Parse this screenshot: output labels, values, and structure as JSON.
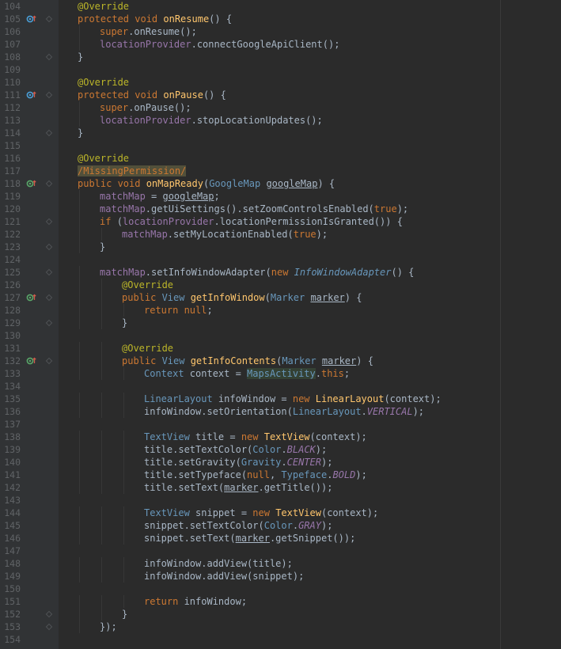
{
  "lines": [
    {
      "n": "104",
      "indent": 1,
      "fold": false,
      "icon": null,
      "segs": [
        {
          "t": "@Override",
          "c": "an"
        }
      ]
    },
    {
      "n": "105",
      "indent": 1,
      "fold": true,
      "icon": "override",
      "segs": [
        {
          "t": "protected ",
          "c": "k"
        },
        {
          "t": "void ",
          "c": "k"
        },
        {
          "t": "onResume",
          "c": "m"
        },
        {
          "t": "() {",
          "c": ""
        }
      ]
    },
    {
      "n": "106",
      "indent": 2,
      "fold": false,
      "icon": null,
      "segs": [
        {
          "t": "super",
          "c": "k"
        },
        {
          "t": ".onResume();",
          "c": ""
        }
      ]
    },
    {
      "n": "107",
      "indent": 2,
      "fold": false,
      "icon": null,
      "segs": [
        {
          "t": "locationProvider",
          "c": "f"
        },
        {
          "t": ".connectGoogleApiClient();",
          "c": ""
        }
      ]
    },
    {
      "n": "108",
      "indent": 1,
      "fold": true,
      "icon": null,
      "segs": [
        {
          "t": "}",
          "c": ""
        }
      ]
    },
    {
      "n": "109",
      "indent": 0,
      "fold": false,
      "icon": null,
      "segs": []
    },
    {
      "n": "110",
      "indent": 1,
      "fold": false,
      "icon": null,
      "segs": [
        {
          "t": "@Override",
          "c": "an"
        }
      ]
    },
    {
      "n": "111",
      "indent": 1,
      "fold": true,
      "icon": "override",
      "segs": [
        {
          "t": "protected ",
          "c": "k"
        },
        {
          "t": "void ",
          "c": "k"
        },
        {
          "t": "onPause",
          "c": "m"
        },
        {
          "t": "() {",
          "c": ""
        }
      ]
    },
    {
      "n": "112",
      "indent": 2,
      "fold": false,
      "icon": null,
      "segs": [
        {
          "t": "super",
          "c": "k"
        },
        {
          "t": ".onPause();",
          "c": ""
        }
      ]
    },
    {
      "n": "113",
      "indent": 2,
      "fold": false,
      "icon": null,
      "segs": [
        {
          "t": "locationProvider",
          "c": "f"
        },
        {
          "t": ".stopLocationUpdates();",
          "c": ""
        }
      ]
    },
    {
      "n": "114",
      "indent": 1,
      "fold": true,
      "icon": null,
      "segs": [
        {
          "t": "}",
          "c": ""
        }
      ]
    },
    {
      "n": "115",
      "indent": 0,
      "fold": false,
      "icon": null,
      "segs": []
    },
    {
      "n": "116",
      "indent": 1,
      "fold": false,
      "icon": null,
      "segs": [
        {
          "t": "@Override",
          "c": "an"
        }
      ]
    },
    {
      "n": "117",
      "indent": 1,
      "fold": false,
      "icon": null,
      "segs": [
        {
          "t": "/MissingPermission/",
          "c": "warn"
        }
      ]
    },
    {
      "n": "118",
      "indent": 1,
      "fold": true,
      "icon": "implement",
      "segs": [
        {
          "t": "public ",
          "c": "k"
        },
        {
          "t": "void ",
          "c": "k"
        },
        {
          "t": "onMapReady",
          "c": "m"
        },
        {
          "t": "(",
          "c": ""
        },
        {
          "t": "GoogleMap ",
          "c": "t"
        },
        {
          "t": "googleMap",
          "c": "u"
        },
        {
          "t": ") {",
          "c": ""
        }
      ]
    },
    {
      "n": "119",
      "indent": 2,
      "fold": false,
      "icon": null,
      "segs": [
        {
          "t": "matchMap",
          "c": "f"
        },
        {
          "t": " = ",
          "c": ""
        },
        {
          "t": "googleMap",
          "c": "u"
        },
        {
          "t": ";",
          "c": ""
        }
      ]
    },
    {
      "n": "120",
      "indent": 2,
      "fold": false,
      "icon": null,
      "segs": [
        {
          "t": "matchMap",
          "c": "f"
        },
        {
          "t": ".getUiSettings().setZoomControlsEnabled(",
          "c": ""
        },
        {
          "t": "true",
          "c": "k"
        },
        {
          "t": ");",
          "c": ""
        }
      ]
    },
    {
      "n": "121",
      "indent": 2,
      "fold": true,
      "icon": null,
      "segs": [
        {
          "t": "if ",
          "c": "k"
        },
        {
          "t": "(",
          "c": ""
        },
        {
          "t": "locationProvider",
          "c": "f"
        },
        {
          "t": ".locationPermissionIsGranted()) {",
          "c": ""
        }
      ]
    },
    {
      "n": "122",
      "indent": 3,
      "fold": false,
      "icon": null,
      "segs": [
        {
          "t": "matchMap",
          "c": "f"
        },
        {
          "t": ".setMyLocationEnabled(",
          "c": ""
        },
        {
          "t": "true",
          "c": "k"
        },
        {
          "t": ");",
          "c": ""
        }
      ]
    },
    {
      "n": "123",
      "indent": 2,
      "fold": true,
      "icon": null,
      "segs": [
        {
          "t": "}",
          "c": ""
        }
      ]
    },
    {
      "n": "124",
      "indent": 0,
      "fold": false,
      "icon": null,
      "segs": []
    },
    {
      "n": "125",
      "indent": 2,
      "fold": true,
      "icon": null,
      "segs": [
        {
          "t": "matchMap",
          "c": "f"
        },
        {
          "t": ".setInfoWindowAdapter(",
          "c": ""
        },
        {
          "t": "new ",
          "c": "k"
        },
        {
          "t": "InfoWindowAdapter",
          "c": "ti"
        },
        {
          "t": "() {",
          "c": ""
        }
      ]
    },
    {
      "n": "126",
      "indent": 3,
      "fold": false,
      "icon": null,
      "segs": [
        {
          "t": "@Override",
          "c": "an"
        }
      ]
    },
    {
      "n": "127",
      "indent": 3,
      "fold": true,
      "icon": "implement",
      "segs": [
        {
          "t": "public ",
          "c": "k"
        },
        {
          "t": "View ",
          "c": "t"
        },
        {
          "t": "getInfoWindow",
          "c": "m"
        },
        {
          "t": "(",
          "c": ""
        },
        {
          "t": "Marker ",
          "c": "t"
        },
        {
          "t": "marker",
          "c": "u"
        },
        {
          "t": ") {",
          "c": ""
        }
      ]
    },
    {
      "n": "128",
      "indent": 4,
      "fold": false,
      "icon": null,
      "segs": [
        {
          "t": "return null",
          "c": "k"
        },
        {
          "t": ";",
          "c": ""
        }
      ]
    },
    {
      "n": "129",
      "indent": 3,
      "fold": true,
      "icon": null,
      "segs": [
        {
          "t": "}",
          "c": ""
        }
      ]
    },
    {
      "n": "130",
      "indent": 0,
      "fold": false,
      "icon": null,
      "segs": []
    },
    {
      "n": "131",
      "indent": 3,
      "fold": false,
      "icon": null,
      "segs": [
        {
          "t": "@Override",
          "c": "an"
        }
      ]
    },
    {
      "n": "132",
      "indent": 3,
      "fold": true,
      "icon": "implement",
      "segs": [
        {
          "t": "public ",
          "c": "k"
        },
        {
          "t": "View ",
          "c": "t"
        },
        {
          "t": "getInfoContents",
          "c": "m"
        },
        {
          "t": "(",
          "c": ""
        },
        {
          "t": "Marker ",
          "c": "t"
        },
        {
          "t": "marker",
          "c": "u"
        },
        {
          "t": ") {",
          "c": ""
        }
      ]
    },
    {
      "n": "133",
      "indent": 4,
      "fold": false,
      "icon": null,
      "segs": [
        {
          "t": "Context ",
          "c": "t"
        },
        {
          "t": "context = ",
          "c": ""
        },
        {
          "t": "MapsActivity",
          "c": "hl"
        },
        {
          "t": ".",
          "c": ""
        },
        {
          "t": "this",
          "c": "k"
        },
        {
          "t": ";",
          "c": ""
        }
      ]
    },
    {
      "n": "134",
      "indent": 0,
      "fold": false,
      "icon": null,
      "segs": []
    },
    {
      "n": "135",
      "indent": 4,
      "fold": false,
      "icon": null,
      "segs": [
        {
          "t": "LinearLayout ",
          "c": "t"
        },
        {
          "t": "infoWindow = ",
          "c": ""
        },
        {
          "t": "new ",
          "c": "k"
        },
        {
          "t": "LinearLayout",
          "c": "m"
        },
        {
          "t": "(context);",
          "c": ""
        }
      ]
    },
    {
      "n": "136",
      "indent": 4,
      "fold": false,
      "icon": null,
      "segs": [
        {
          "t": "infoWindow.setOrientation(",
          "c": ""
        },
        {
          "t": "LinearLayout",
          "c": "t"
        },
        {
          "t": ".",
          "c": ""
        },
        {
          "t": "VERTICAL",
          "c": "c"
        },
        {
          "t": ");",
          "c": ""
        }
      ]
    },
    {
      "n": "137",
      "indent": 0,
      "fold": false,
      "icon": null,
      "segs": []
    },
    {
      "n": "138",
      "indent": 4,
      "fold": false,
      "icon": null,
      "segs": [
        {
          "t": "TextView ",
          "c": "t"
        },
        {
          "t": "title = ",
          "c": ""
        },
        {
          "t": "new ",
          "c": "k"
        },
        {
          "t": "TextView",
          "c": "m"
        },
        {
          "t": "(context);",
          "c": ""
        }
      ]
    },
    {
      "n": "139",
      "indent": 4,
      "fold": false,
      "icon": null,
      "segs": [
        {
          "t": "title.setTextColor(",
          "c": ""
        },
        {
          "t": "Color",
          "c": "t"
        },
        {
          "t": ".",
          "c": ""
        },
        {
          "t": "BLACK",
          "c": "c"
        },
        {
          "t": ");",
          "c": ""
        }
      ]
    },
    {
      "n": "140",
      "indent": 4,
      "fold": false,
      "icon": null,
      "segs": [
        {
          "t": "title.setGravity(",
          "c": ""
        },
        {
          "t": "Gravity",
          "c": "t"
        },
        {
          "t": ".",
          "c": ""
        },
        {
          "t": "CENTER",
          "c": "c"
        },
        {
          "t": ");",
          "c": ""
        }
      ]
    },
    {
      "n": "141",
      "indent": 4,
      "fold": false,
      "icon": null,
      "segs": [
        {
          "t": "title.setTypeface(",
          "c": ""
        },
        {
          "t": "null",
          "c": "k"
        },
        {
          "t": ", ",
          "c": ""
        },
        {
          "t": "Typeface",
          "c": "t"
        },
        {
          "t": ".",
          "c": ""
        },
        {
          "t": "BOLD",
          "c": "c"
        },
        {
          "t": ");",
          "c": ""
        }
      ]
    },
    {
      "n": "142",
      "indent": 4,
      "fold": false,
      "icon": null,
      "segs": [
        {
          "t": "title.setText(",
          "c": ""
        },
        {
          "t": "marker",
          "c": "u"
        },
        {
          "t": ".getTitle());",
          "c": ""
        }
      ]
    },
    {
      "n": "143",
      "indent": 0,
      "fold": false,
      "icon": null,
      "segs": []
    },
    {
      "n": "144",
      "indent": 4,
      "fold": false,
      "icon": null,
      "segs": [
        {
          "t": "TextView ",
          "c": "t"
        },
        {
          "t": "snippet = ",
          "c": ""
        },
        {
          "t": "new ",
          "c": "k"
        },
        {
          "t": "TextView",
          "c": "m"
        },
        {
          "t": "(context);",
          "c": ""
        }
      ]
    },
    {
      "n": "145",
      "indent": 4,
      "fold": false,
      "icon": null,
      "segs": [
        {
          "t": "snippet.setTextColor(",
          "c": ""
        },
        {
          "t": "Color",
          "c": "t"
        },
        {
          "t": ".",
          "c": ""
        },
        {
          "t": "GRAY",
          "c": "c"
        },
        {
          "t": ");",
          "c": ""
        }
      ]
    },
    {
      "n": "146",
      "indent": 4,
      "fold": false,
      "icon": null,
      "segs": [
        {
          "t": "snippet.setText(",
          "c": ""
        },
        {
          "t": "marker",
          "c": "u"
        },
        {
          "t": ".getSnippet());",
          "c": ""
        }
      ]
    },
    {
      "n": "147",
      "indent": 0,
      "fold": false,
      "icon": null,
      "segs": []
    },
    {
      "n": "148",
      "indent": 4,
      "fold": false,
      "icon": null,
      "segs": [
        {
          "t": "infoWindow.addView(title);",
          "c": ""
        }
      ]
    },
    {
      "n": "149",
      "indent": 4,
      "fold": false,
      "icon": null,
      "segs": [
        {
          "t": "infoWindow.addView(snippet);",
          "c": ""
        }
      ]
    },
    {
      "n": "150",
      "indent": 0,
      "fold": false,
      "icon": null,
      "segs": []
    },
    {
      "n": "151",
      "indent": 4,
      "fold": false,
      "icon": null,
      "segs": [
        {
          "t": "return ",
          "c": "k"
        },
        {
          "t": "infoWindow;",
          "c": ""
        }
      ]
    },
    {
      "n": "152",
      "indent": 3,
      "fold": true,
      "icon": null,
      "segs": [
        {
          "t": "}",
          "c": ""
        }
      ]
    },
    {
      "n": "153",
      "indent": 2,
      "fold": true,
      "icon": null,
      "segs": [
        {
          "t": "});",
          "c": ""
        }
      ]
    },
    {
      "n": "154",
      "indent": 0,
      "fold": false,
      "icon": null,
      "segs": []
    }
  ],
  "colors": {
    "background": "#2b2b2b",
    "gutter": "#313335",
    "keyword": "#cc7832",
    "annotation": "#bbb529",
    "field": "#9876aa",
    "method": "#ffc66d",
    "type": "#6897bb",
    "text": "#a9b7c6"
  }
}
